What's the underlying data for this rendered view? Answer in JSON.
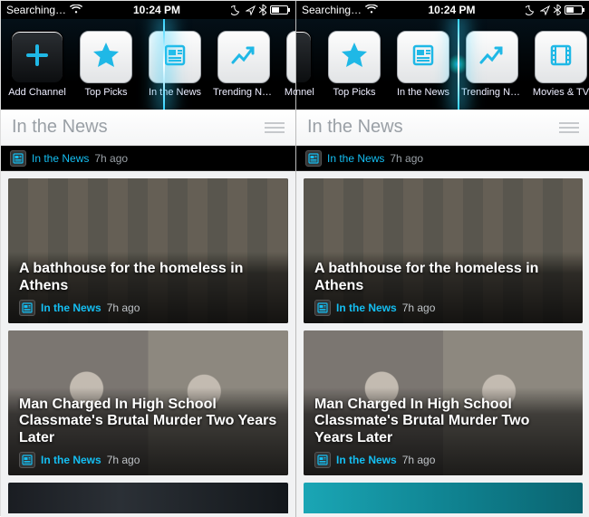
{
  "statusbar": {
    "carrier": "Searching…",
    "time": "10:24 PM"
  },
  "channels": {
    "add": {
      "label": "Add Channel",
      "icon": "plus"
    },
    "items": [
      {
        "key": "top-picks",
        "label": "Top Picks",
        "icon": "star"
      },
      {
        "key": "in-the-news",
        "label": "In the News",
        "icon": "newspaper"
      },
      {
        "key": "trending-now",
        "label": "Trending Now",
        "icon": "trending"
      },
      {
        "key": "movies-tv",
        "label": "Movies & TV",
        "icon": "film"
      }
    ]
  },
  "section": {
    "title": "In the News"
  },
  "feed": {
    "top_strip": {
      "source": "In the News",
      "age": "7h ago"
    },
    "cards": [
      {
        "headline": "A bathhouse for the homeless in Athens",
        "source": "In the News",
        "age": "7h ago"
      },
      {
        "headline": "Man Charged In High School Classmate's Brutal Murder Two Years Later",
        "source": "In the News",
        "age": "7h ago"
      }
    ]
  },
  "colors": {
    "accent": "#14bff3"
  }
}
